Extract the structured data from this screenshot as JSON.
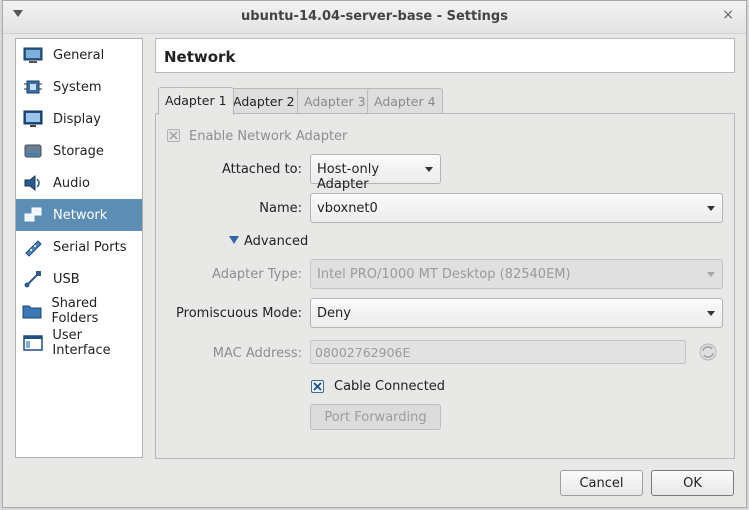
{
  "window": {
    "title": "ubuntu-14.04-server-base - Settings",
    "menu_icon": "window-menu-icon",
    "close_glyph": "×"
  },
  "sidebar": {
    "items": [
      {
        "label": "General",
        "icon": "general-icon"
      },
      {
        "label": "System",
        "icon": "chip-icon"
      },
      {
        "label": "Display",
        "icon": "monitor-icon"
      },
      {
        "label": "Storage",
        "icon": "storage-icon"
      },
      {
        "label": "Audio",
        "icon": "speaker-icon"
      },
      {
        "label": "Network",
        "icon": "network-icon",
        "active": true
      },
      {
        "label": "Serial Ports",
        "icon": "serial-port-icon"
      },
      {
        "label": "USB",
        "icon": "usb-icon"
      },
      {
        "label": "Shared Folders",
        "icon": "folder-icon"
      },
      {
        "label": "User Interface",
        "icon": "user-interface-icon"
      }
    ]
  },
  "header": {
    "title": "Network"
  },
  "tabs": [
    {
      "label": "Adapter 1",
      "active": true
    },
    {
      "label": "Adapter 2",
      "active": false
    },
    {
      "label": "Adapter 3",
      "disabled": true
    },
    {
      "label": "Adapter 4",
      "disabled": true
    }
  ],
  "adapter": {
    "enable_label": "Enable Network Adapter",
    "enable_checked": true,
    "attached_to_label": "Attached to:",
    "attached_to_value": "Host-only Adapter",
    "name_label": "Name:",
    "name_value": "vboxnet0",
    "advanced_label": "Advanced",
    "adapter_type_label": "Adapter Type:",
    "adapter_type_value": "Intel PRO/1000 MT Desktop (82540EM)",
    "promiscuous_label": "Promiscuous Mode:",
    "promiscuous_value": "Deny",
    "mac_label": "MAC Address:",
    "mac_value": "08002762906E",
    "cable_label": "Cable Connected",
    "cable_checked": true,
    "port_forwarding_label": "Port Forwarding"
  },
  "buttons": {
    "cancel": "Cancel",
    "ok": "OK"
  },
  "colors": {
    "selection": "#5b8db5",
    "accent_blue": "#3d6a96"
  }
}
